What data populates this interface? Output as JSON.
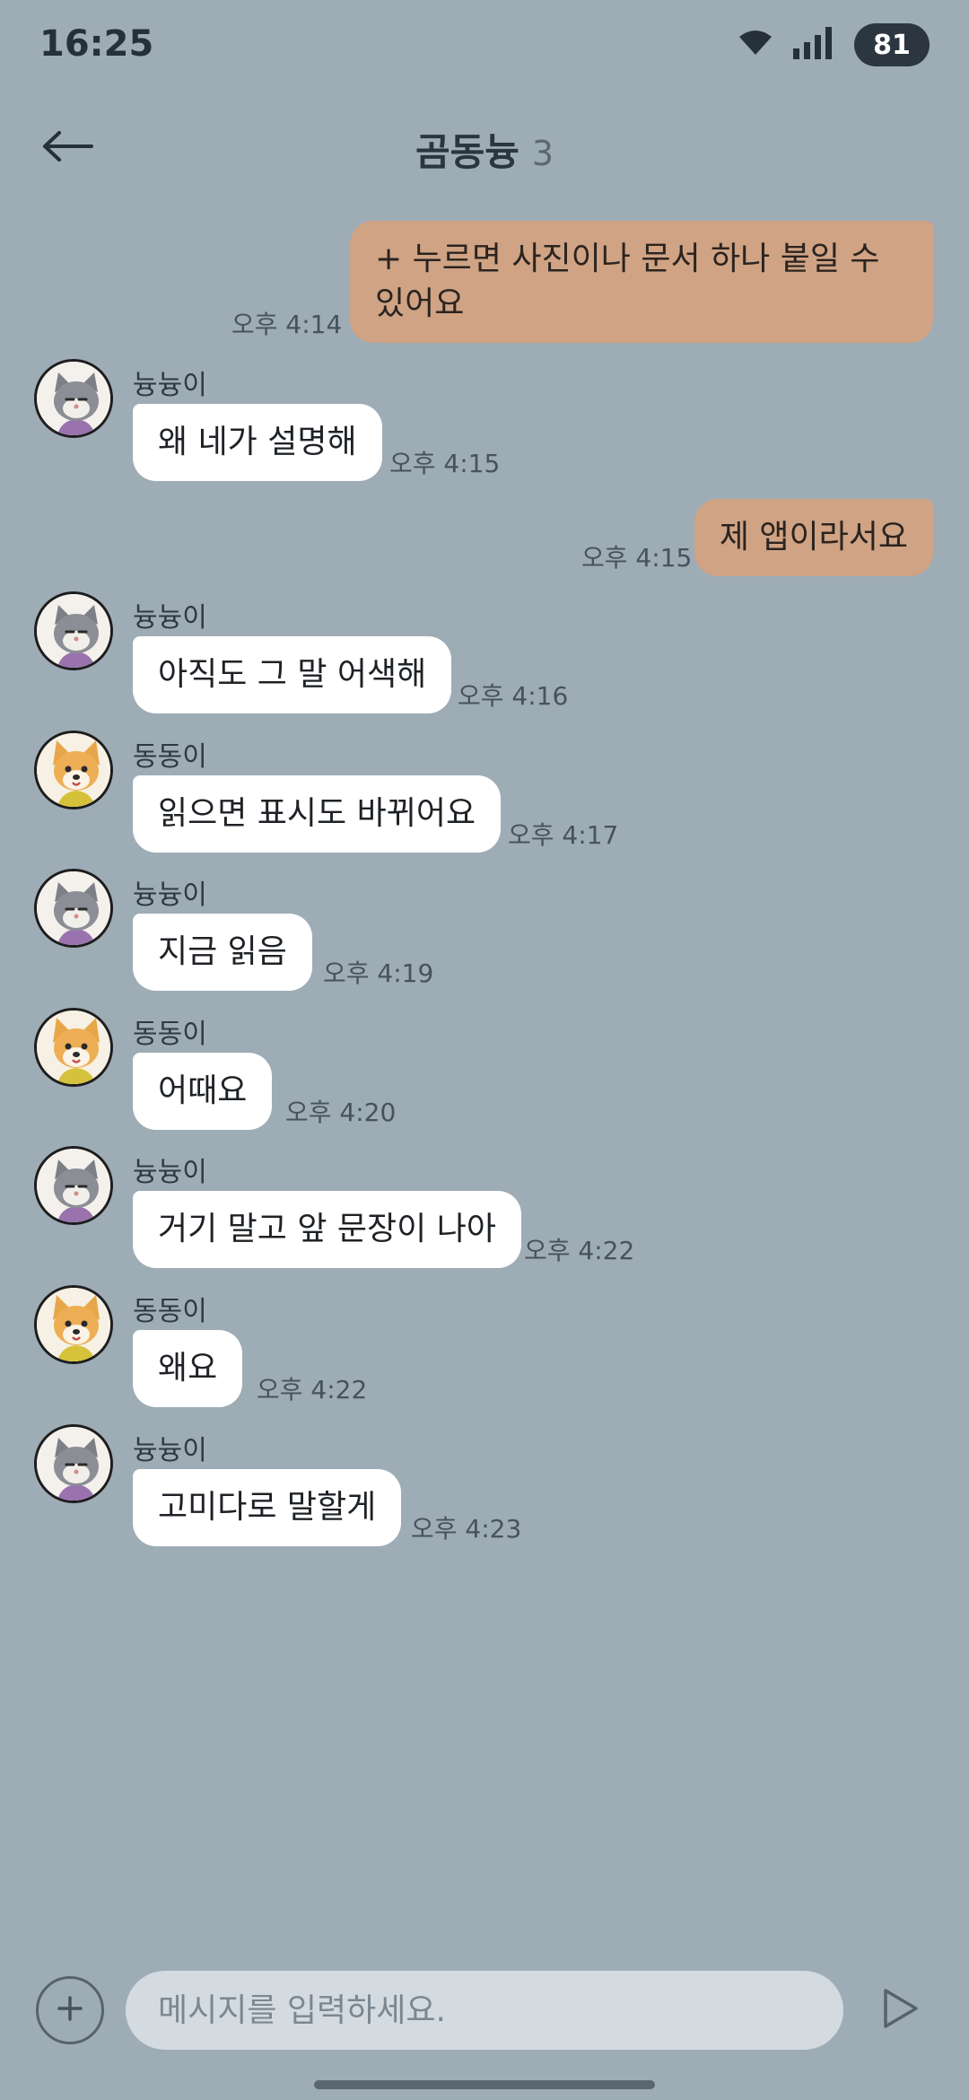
{
  "status_bar": {
    "time": "16:25",
    "battery": "81",
    "icons": [
      "wifi-icon",
      "signal-icon"
    ]
  },
  "header": {
    "back_icon": "arrow-left-icon",
    "title": "곰동늉",
    "member_count": "3"
  },
  "messages": [
    {
      "direction": "out",
      "text": "+ 누르면 사진이나 문서 하나 붙일 수 있어요",
      "time": "오후 4:14"
    },
    {
      "direction": "in",
      "sender": "늉늉이",
      "avatar": "cat",
      "text": "왜 네가 설명해",
      "time": "오후 4:15"
    },
    {
      "direction": "out",
      "text": "제 앱이라서요",
      "time": "오후 4:15"
    },
    {
      "direction": "in",
      "sender": "늉늉이",
      "avatar": "cat",
      "text": "아직도 그 말 어색해",
      "time": "오후 4:16"
    },
    {
      "direction": "in",
      "sender": "동동이",
      "avatar": "dog",
      "text": "읽으면 표시도 바뀌어요",
      "time": "오후 4:17"
    },
    {
      "direction": "in",
      "sender": "늉늉이",
      "avatar": "cat",
      "text": "지금 읽음",
      "time": "오후 4:19"
    },
    {
      "direction": "in",
      "sender": "동동이",
      "avatar": "dog",
      "text": "어때요",
      "time": "오후 4:20"
    },
    {
      "direction": "in",
      "sender": "늉늉이",
      "avatar": "cat",
      "text": "거기 말고 앞 문장이 나아",
      "time": "오후 4:22"
    },
    {
      "direction": "in",
      "sender": "동동이",
      "avatar": "dog",
      "text": "왜요",
      "time": "오후 4:22"
    },
    {
      "direction": "in",
      "sender": "늉늉이",
      "avatar": "cat",
      "text": "고미다로 말할게",
      "time": "오후 4:23"
    }
  ],
  "input_bar": {
    "placeholder": "메시지를 입력하세요.",
    "value": "",
    "attach_icon": "plus-icon",
    "send_icon": "send-icon"
  },
  "colors": {
    "background": "#9eacb6",
    "outgoing_bubble": "#cfa384",
    "incoming_bubble": "#ffffff",
    "input_field": "#d3dbe1"
  }
}
